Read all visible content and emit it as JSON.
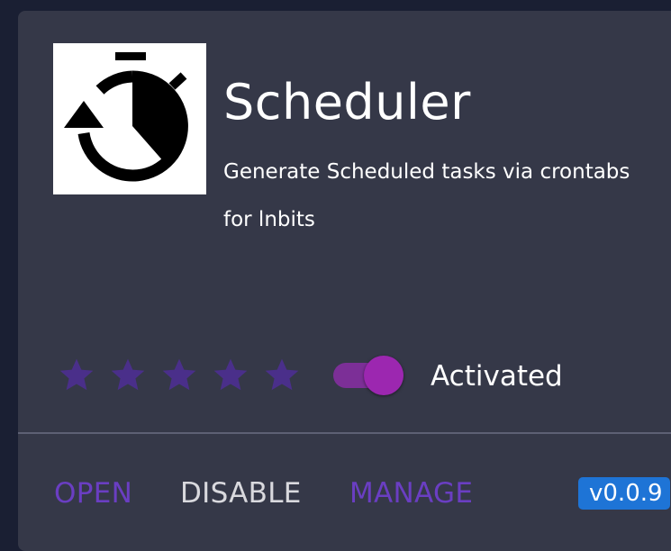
{
  "extension": {
    "title": "Scheduler",
    "description": "Generate Scheduled tasks via crontabs for lnbits",
    "logo_icon": "stopwatch-restore-icon",
    "rating": {
      "stars_total": 5,
      "stars_filled": 5,
      "star_color": "#4a2f8a"
    },
    "toggle": {
      "label": "Activated",
      "state": true,
      "color": "#9c27b0"
    },
    "actions": {
      "open_label": "OPEN",
      "disable_label": "DISABLE",
      "manage_label": "MANAGE"
    },
    "version": "v0.0.9"
  },
  "colors": {
    "page_background": "#1a1f33",
    "card_background": "#353848",
    "accent_purple": "#6a3ec2",
    "version_badge": "#1e74d6"
  }
}
